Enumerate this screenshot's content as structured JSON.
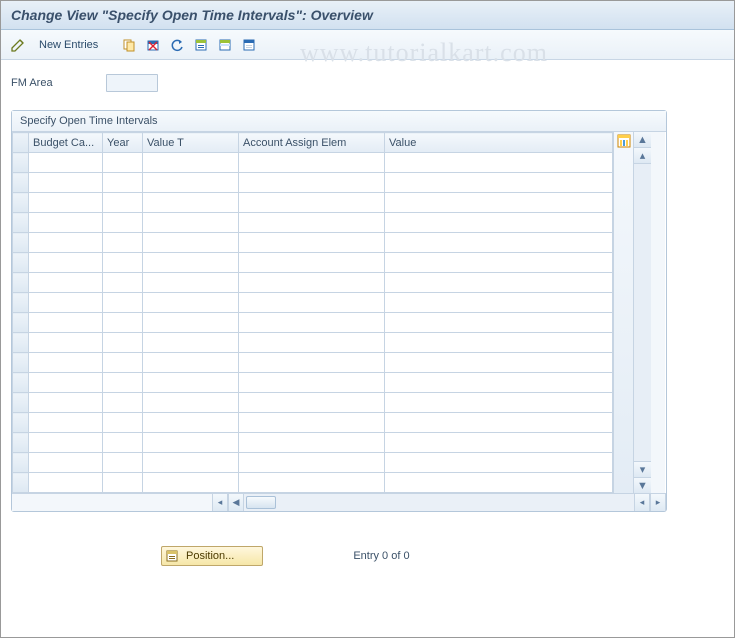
{
  "title": "Change View \"Specify Open Time Intervals\": Overview",
  "toolbar": {
    "new_entries_label": "New Entries"
  },
  "watermark_text": "www.tutorialkart.com",
  "fields": {
    "fm_area_label": "FM Area",
    "fm_area_value": ""
  },
  "panel": {
    "title": "Specify Open Time Intervals",
    "columns": [
      "Budget Ca...",
      "Year",
      "Value T",
      "Account Assign Elem",
      "Value"
    ],
    "row_count": 17
  },
  "footer": {
    "position_label": "Position...",
    "entry_text": "Entry 0 of 0"
  }
}
